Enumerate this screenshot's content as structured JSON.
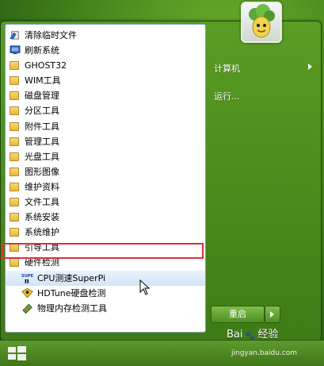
{
  "programs": [
    {
      "label": "清除临时文件",
      "icon": "clear-temp-icon"
    },
    {
      "label": "刷新系统",
      "icon": "refresh-system-icon"
    },
    {
      "label": "GHOST32",
      "icon": "folder-icon"
    },
    {
      "label": "WIM工具",
      "icon": "folder-icon"
    },
    {
      "label": "磁盘管理",
      "icon": "folder-icon"
    },
    {
      "label": "分区工具",
      "icon": "folder-icon"
    },
    {
      "label": "附件工具",
      "icon": "folder-icon"
    },
    {
      "label": "管理工具",
      "icon": "folder-icon"
    },
    {
      "label": "光盘工具",
      "icon": "folder-icon"
    },
    {
      "label": "图形图像",
      "icon": "folder-icon"
    },
    {
      "label": "维护资料",
      "icon": "folder-icon"
    },
    {
      "label": "文件工具",
      "icon": "folder-icon"
    },
    {
      "label": "系统安装",
      "icon": "folder-icon"
    },
    {
      "label": "系统维护",
      "icon": "folder-icon"
    },
    {
      "label": "引导工具",
      "icon": "folder-icon"
    },
    {
      "label": "硬件检测",
      "icon": "folder-icon"
    },
    {
      "label": "CPU测速SuperPi",
      "icon": "superpi-icon",
      "selected": true
    },
    {
      "label": "HDTune硬盘检测",
      "icon": "hdtune-icon"
    },
    {
      "label": "物理内存检测工具",
      "icon": "memtest-icon"
    }
  ],
  "superpi_icon_text": "SUPER",
  "right": {
    "computer": "计算机",
    "run": "运行..."
  },
  "shutdown": {
    "label": "重启"
  },
  "watermark": {
    "brand": "Bai",
    "brand_suffix": "经验",
    "url": "jingyan.baidu.com"
  },
  "colors": {
    "highlight_box": "#d8323a",
    "menu_green": "#4f8e22"
  }
}
